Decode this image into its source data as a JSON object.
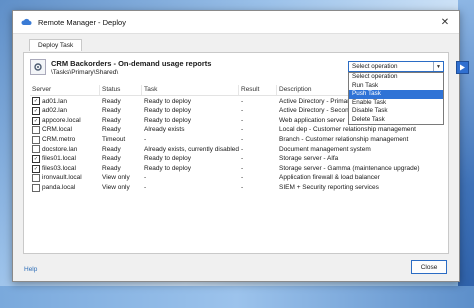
{
  "window": {
    "title": "Remote Manager - Deploy",
    "close_glyph": "✕"
  },
  "tab": {
    "label": "Deploy Task"
  },
  "task": {
    "title": "CRM Backorders - On-demand usage reports",
    "path": "\\Tasks\\Primary\\Shared\\"
  },
  "operation": {
    "selected": "Select operation",
    "options": [
      "Select operation",
      "Run Task",
      "Push Task",
      "Enable Task",
      "Disable Task",
      "Delete Task"
    ],
    "highlighted_index": 2
  },
  "grid": {
    "headers": {
      "server": "Server",
      "status": "Status",
      "task": "Task",
      "result": "Result",
      "description": "Description"
    },
    "rows": [
      {
        "checked": true,
        "server": "ad01.lan",
        "status": "Ready",
        "task": "Ready to deploy",
        "result": "-",
        "description": "Active Directory - Primary domain controller"
      },
      {
        "checked": true,
        "server": "ad02.lan",
        "status": "Ready",
        "task": "Ready to deploy",
        "result": "-",
        "description": "Active Directory - Secondary domain controller"
      },
      {
        "checked": true,
        "server": "appcore.local",
        "status": "Ready",
        "task": "Ready to deploy",
        "result": "-",
        "description": "Web application server"
      },
      {
        "checked": false,
        "server": "CRM.local",
        "status": "Ready",
        "task": "Already exists",
        "result": "-",
        "description": "Local dep - Customer relationship management"
      },
      {
        "checked": false,
        "server": "CRM.metro",
        "status": "Timeout",
        "task": "-",
        "result": "-",
        "description": "Branch - Customer relationship management"
      },
      {
        "checked": false,
        "server": "docstore.lan",
        "status": "Ready",
        "task": "Already exists, currently disabled",
        "result": "-",
        "description": "Document management system"
      },
      {
        "checked": true,
        "server": "files01.local",
        "status": "Ready",
        "task": "Ready to deploy",
        "result": "-",
        "description": "Storage server - Alfa"
      },
      {
        "checked": true,
        "server": "files03.local",
        "status": "Ready",
        "task": "Ready to deploy",
        "result": "-",
        "description": "Storage server - Gamma (maintenance upgrade)"
      },
      {
        "checked": false,
        "server": "ironvault.local",
        "status": "View only",
        "task": "-",
        "result": "-",
        "description": "Application firewall & load balancer"
      },
      {
        "checked": false,
        "server": "panda.local",
        "status": "View only",
        "task": "-",
        "result": "-",
        "description": "SIEM + Security reporting services"
      }
    ]
  },
  "footer": {
    "help_label": "Help",
    "close_label": "Close"
  },
  "colors": {
    "accent": "#2f73d6",
    "link": "#2f6fb8"
  }
}
